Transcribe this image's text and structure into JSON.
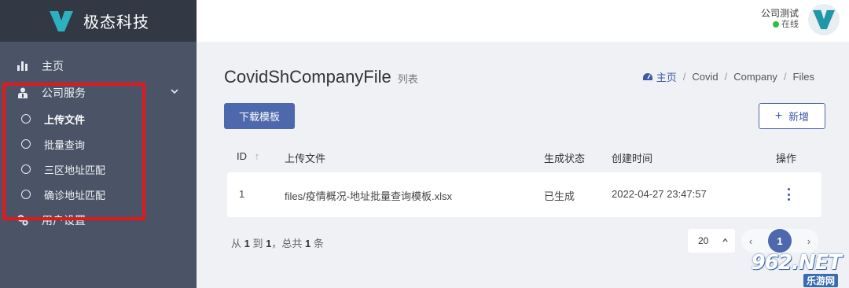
{
  "brand": {
    "name": "极态科技"
  },
  "sidebar": {
    "items": [
      {
        "label": "主页"
      },
      {
        "label": "公司服务"
      },
      {
        "label": "用户设置"
      }
    ],
    "submenu": [
      {
        "label": "上传文件"
      },
      {
        "label": "批量查询"
      },
      {
        "label": "三区地址匹配"
      },
      {
        "label": "确诊地址匹配"
      }
    ]
  },
  "user": {
    "name": "公司测试",
    "status": "在线"
  },
  "page": {
    "title": "CovidShCompanyFile",
    "subtitle": "列表"
  },
  "breadcrumb": [
    "主页",
    "Covid",
    "Company",
    "Files"
  ],
  "toolbar": {
    "download_label": "下载模板",
    "add_label": "新增"
  },
  "table": {
    "headers": {
      "id": "ID",
      "file": "上传文件",
      "status": "生成状态",
      "created": "创建时间",
      "actions": "操作"
    },
    "rows": [
      {
        "id": "1",
        "file": "files/疫情概况-地址批量查询模板.xlsx",
        "status": "已生成",
        "created": "2022-04-27 23:47:57"
      }
    ]
  },
  "pagination": {
    "summary_prefix": "从",
    "from": "1",
    "to_label": "到",
    "to": "1",
    "total_label": "，总共",
    "total": "1",
    "unit": "条",
    "page_size": "20",
    "current_page": "1"
  },
  "watermark": {
    "text": "962.NET",
    "sub": "乐游网"
  },
  "colors": {
    "sidebar": "#4a5466",
    "brand_bar": "#323944",
    "accent": "#4d68ad",
    "highlight": "#e0191f",
    "online": "#27c24c"
  }
}
